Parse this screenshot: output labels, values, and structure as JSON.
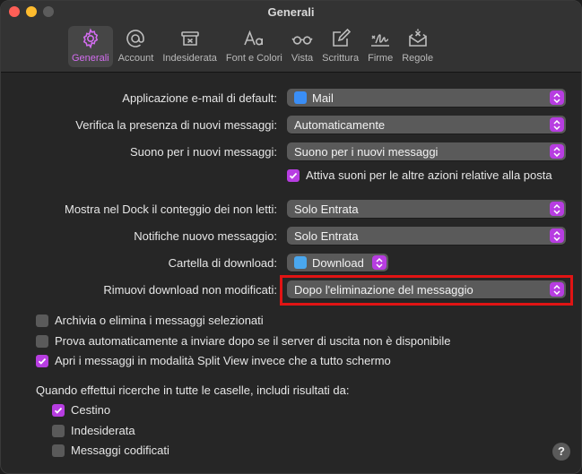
{
  "window": {
    "title": "Generali"
  },
  "toolbar": {
    "tabs": [
      {
        "id": "generali",
        "label": "Generali",
        "icon": "gear-icon",
        "selected": true
      },
      {
        "id": "account",
        "label": "Account",
        "icon": "at-icon",
        "selected": false
      },
      {
        "id": "indesiderata",
        "label": "Indesiderata",
        "icon": "junk-tray-icon",
        "selected": false
      },
      {
        "id": "font",
        "label": "Font e Colori",
        "icon": "font-icon",
        "selected": false
      },
      {
        "id": "vista",
        "label": "Vista",
        "icon": "glasses-icon",
        "selected": false
      },
      {
        "id": "scrittura",
        "label": "Scrittura",
        "icon": "compose-icon",
        "selected": false
      },
      {
        "id": "firme",
        "label": "Firme",
        "icon": "signature-icon",
        "selected": false
      },
      {
        "id": "regole",
        "label": "Regole",
        "icon": "rules-envelope-icon",
        "selected": false
      }
    ]
  },
  "settings": {
    "default_app": {
      "label": "Applicazione e-mail di default:",
      "value": "Mail"
    },
    "check_mail": {
      "label": "Verifica la presenza di nuovi messaggi:",
      "value": "Automaticamente"
    },
    "new_mail_sound": {
      "label": "Suono per i nuovi messaggi:",
      "value": "Suono per i nuovi messaggi"
    },
    "other_sounds": {
      "label": "Attiva suoni per le altre azioni relative alla posta",
      "checked": true
    },
    "dock_count": {
      "label": "Mostra nel Dock il conteggio dei non letti:",
      "value": "Solo Entrata"
    },
    "notifications": {
      "label": "Notifiche nuovo messaggio:",
      "value": "Solo Entrata"
    },
    "download_folder": {
      "label": "Cartella di download:",
      "value": "Download"
    },
    "remove_downloads": {
      "label": "Rimuovi download non modificati:",
      "value": "Dopo l'eliminazione del messaggio"
    }
  },
  "checkboxes": {
    "archive": {
      "label": "Archivia o elimina i messaggi selezionati",
      "checked": false
    },
    "retry_send": {
      "label": "Prova automaticamente a inviare dopo se il server di uscita non è disponibile",
      "checked": false
    },
    "split_view": {
      "label": "Apri i messaggi in modalità Split View invece che a tutto schermo",
      "checked": true
    }
  },
  "search": {
    "heading": "Quando effettui ricerche in tutte le caselle, includi risultati da:",
    "options": [
      {
        "label": "Cestino",
        "checked": true
      },
      {
        "label": "Indesiderata",
        "checked": false
      },
      {
        "label": "Messaggi codificati",
        "checked": false
      }
    ]
  },
  "help": {
    "label": "?"
  },
  "colors": {
    "accent": "#b73de1",
    "highlight": "#e01414",
    "background": "#262626",
    "popup": "#5a5a5a"
  }
}
